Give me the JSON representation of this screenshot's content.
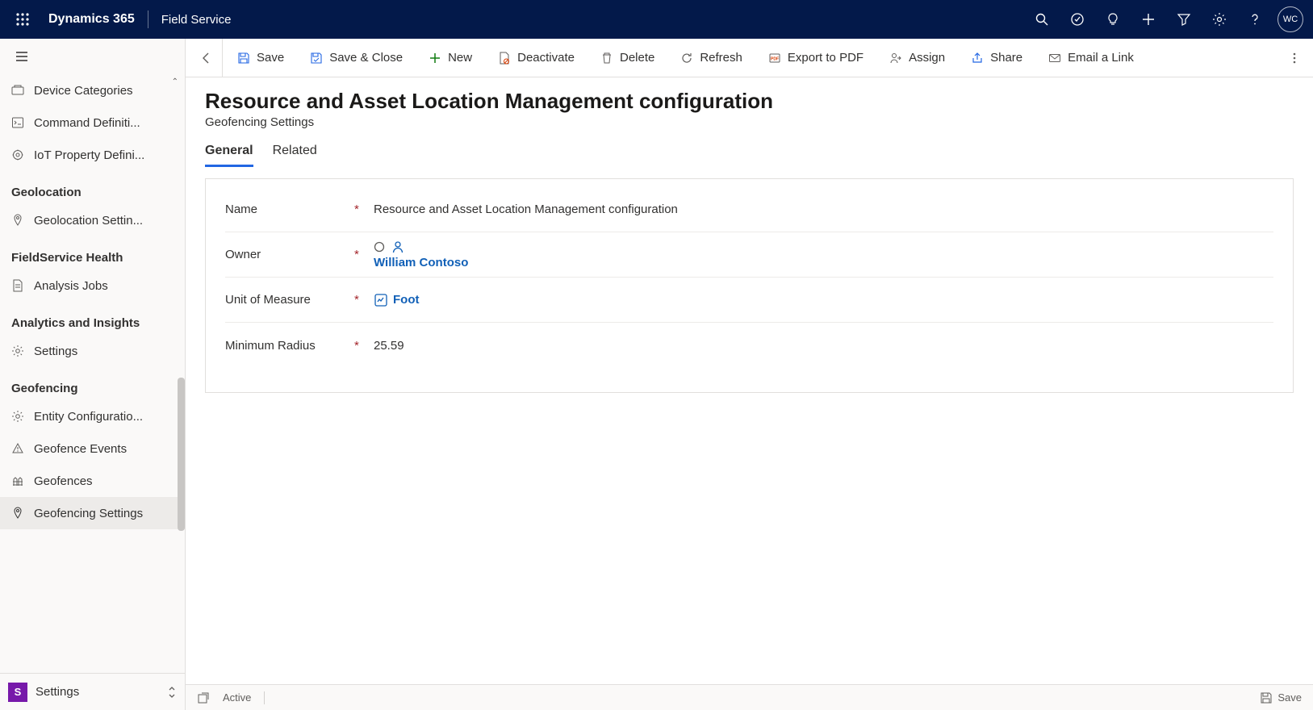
{
  "topbar": {
    "brand": "Dynamics 365",
    "app": "Field Service",
    "avatar": "WC"
  },
  "sidebar": {
    "items_top": [
      {
        "label": "Device Categories",
        "icon": "category"
      },
      {
        "label": "Command Definiti...",
        "icon": "command"
      },
      {
        "label": "IoT Property Defini...",
        "icon": "iot"
      }
    ],
    "groups": [
      {
        "title": "Geolocation",
        "items": [
          {
            "label": "Geolocation Settin...",
            "icon": "pin"
          }
        ]
      },
      {
        "title": "FieldService Health",
        "items": [
          {
            "label": "Analysis Jobs",
            "icon": "doc"
          }
        ]
      },
      {
        "title": "Analytics and Insights",
        "items": [
          {
            "label": "Settings",
            "icon": "gear"
          }
        ]
      },
      {
        "title": "Geofencing",
        "items": [
          {
            "label": "Entity Configuratio...",
            "icon": "gear"
          },
          {
            "label": "Geofence Events",
            "icon": "warn"
          },
          {
            "label": "Geofences",
            "icon": "fence"
          },
          {
            "label": "Geofencing Settings",
            "icon": "pin",
            "active": true
          }
        ]
      }
    ],
    "footer": {
      "letter": "S",
      "label": "Settings"
    }
  },
  "cmdbar": {
    "save": "Save",
    "saveclose": "Save & Close",
    "new": "New",
    "deactivate": "Deactivate",
    "delete": "Delete",
    "refresh": "Refresh",
    "export": "Export to PDF",
    "assign": "Assign",
    "share": "Share",
    "email": "Email a Link"
  },
  "page": {
    "title": "Resource and Asset Location Management configuration",
    "subtitle": "Geofencing Settings",
    "tabs": {
      "general": "General",
      "related": "Related"
    },
    "form": {
      "name_label": "Name",
      "name_value": "Resource and Asset Location Management configuration",
      "owner_label": "Owner",
      "owner_value": "William Contoso",
      "uom_label": "Unit of Measure",
      "uom_value": "Foot",
      "radius_label": "Minimum Radius",
      "radius_value": "25.59"
    }
  },
  "statusbar": {
    "status": "Active",
    "save": "Save"
  }
}
